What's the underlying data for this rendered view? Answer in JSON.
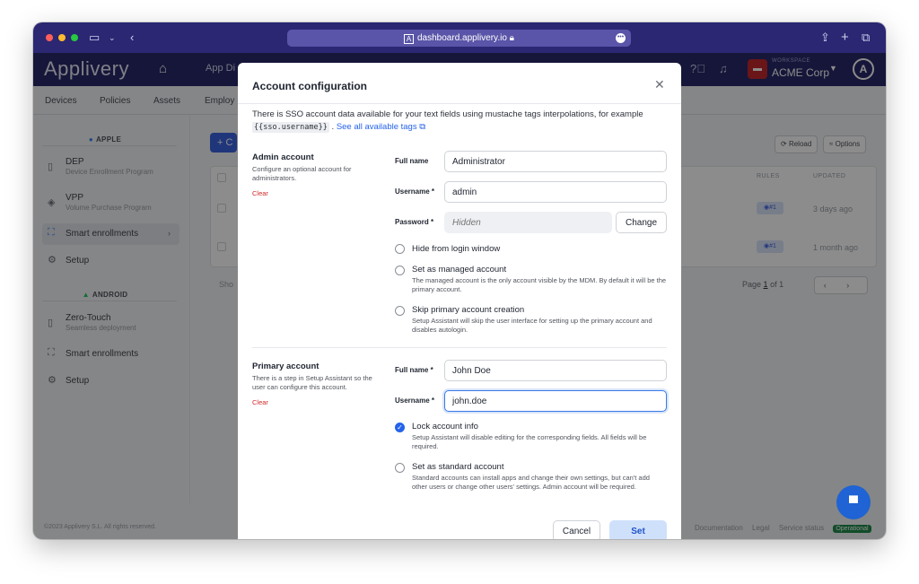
{
  "browser": {
    "url": "dashboard.applivery.io",
    "traffic_colors": [
      "#ff5f57",
      "#febc2e",
      "#28c840"
    ]
  },
  "header": {
    "logo": "Applivery",
    "nav_partial": "App Di",
    "workspace_label": "WORKSPACE",
    "workspace_name": "ACME Corp",
    "avatar_letter": "A"
  },
  "subnav": [
    "Devices",
    "Policies",
    "Assets",
    "Employ"
  ],
  "sidebar": {
    "apple_label": "APPLE",
    "android_label": "ANDROID",
    "apple_items": [
      {
        "title": "DEP",
        "subtitle": "Device Enrollment Program"
      },
      {
        "title": "VPP",
        "subtitle": "Volume Purchase Program"
      },
      {
        "title": "Smart enrollments",
        "subtitle": ""
      },
      {
        "title": "Setup",
        "subtitle": ""
      }
    ],
    "android_items": [
      {
        "title": "Zero-Touch",
        "subtitle": "Seamless deployment"
      },
      {
        "title": "Smart enrollments",
        "subtitle": ""
      },
      {
        "title": "Setup",
        "subtitle": ""
      }
    ]
  },
  "background": {
    "new_button": "+ C",
    "reload": "Reload",
    "options": "Options",
    "columns": [
      "RULES",
      "UPDATED"
    ],
    "rows": [
      {
        "rules": "#1",
        "updated": "3 days ago"
      },
      {
        "rules": "#1",
        "updated": "1 month ago"
      }
    ],
    "show": "Sho",
    "page_label": "Page",
    "page_num": "1",
    "page_of": "of 1",
    "pager": "‹ ›"
  },
  "footer": {
    "copyright": "©2023 Applivery S.L. All rights reserved.",
    "links": [
      "Documentation",
      "Legal",
      "Service status"
    ],
    "status": "Operational"
  },
  "modal": {
    "title": "Account configuration",
    "info_prefix": "There is SSO account data available for your text fields using mustache tags interpolations, for example",
    "info_code": "{{sso.username}}",
    "info_sep": ".",
    "info_link": "See all available tags",
    "admin": {
      "title": "Admin account",
      "desc": "Configure an optional account for administrators.",
      "clear": "Clear",
      "fullname_label": "Full name",
      "fullname_value": "Administrator",
      "username_label": "Username *",
      "username_value": "admin",
      "password_label": "Password *",
      "password_placeholder": "Hidden",
      "change": "Change",
      "options": [
        {
          "title": "Hide from login window",
          "desc": "",
          "checked": false
        },
        {
          "title": "Set as managed account",
          "desc": "The managed account is the only account visible by the MDM. By default it will be the primary account.",
          "checked": false
        },
        {
          "title": "Skip primary account creation",
          "desc": "Setup Assistant will skip the user interface for setting up the primary account and disables autologin.",
          "checked": false
        }
      ]
    },
    "primary": {
      "title": "Primary account",
      "desc": "There is a step in Setup Assistant so the user can configure this account.",
      "clear": "Clear",
      "fullname_label": "Full name *",
      "fullname_value": "John Doe",
      "username_label": "Username *",
      "username_value": "john.doe",
      "options": [
        {
          "title": "Lock account info",
          "desc": "Setup Assistant will disable editing for the corresponding fields. All fields will be required.",
          "checked": true
        },
        {
          "title": "Set as standard account",
          "desc": "Standard accounts can install apps and change their own settings, but can't add other users or change other users' settings. Admin account will be required.",
          "checked": false
        }
      ]
    },
    "cancel": "Cancel",
    "set": "Set"
  }
}
